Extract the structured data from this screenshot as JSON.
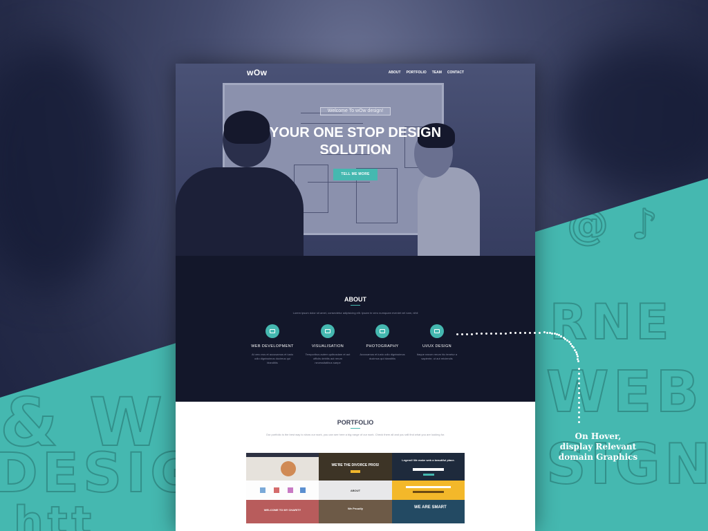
{
  "mockup": {
    "logo": "wOw",
    "nav": [
      "ABOUT",
      "PORTFOLIO",
      "TEAM",
      "CONTACT"
    ],
    "hero": {
      "welcome": "Welcome To wOw design!",
      "title_line1": "YOUR ONE STOP DESIGN",
      "title_line2": "SOLUTION",
      "button": "TELL ME MORE"
    },
    "about": {
      "title": "ABOUT",
      "subtitle": "Lorem ipsum dolor sit amet, consectetur adipisicing elit. Ipsam in vero numquam eveniet vel nam, nihil",
      "services": [
        {
          "title": "WEB DEVELOPMENT",
          "desc": "At vero eos et accusamus et iusto odio dignissimos ducimus qui blanditiis",
          "icon": "camera-icon"
        },
        {
          "title": "VISUALISATION",
          "desc": "Temporibus autem quibusdam et aut officiis debitis aut rerum necessitatibus saepe",
          "icon": "image-icon"
        },
        {
          "title": "PHOTOGRAPHY",
          "desc": "Accusamus et iusto odio dignissimos ducimus qui blanditiis",
          "icon": "calendar-icon"
        },
        {
          "title": "UI/UX DESIGN",
          "desc": "Itaque earum rerum hic tenetur a sapiente, ut aut reiciendis",
          "icon": "cube-icon"
        }
      ]
    },
    "portfolio": {
      "title": "PORTFOLIO",
      "subtitle": "Our portfolio is the best way to show our work, you can see here a big range of our work. Check them all and you will find what you are looking for.",
      "tiles": [
        {
          "caption": ""
        },
        {
          "caption": "WE'RE THE DIVORCE PROS!"
        },
        {
          "caption": "Legend! We make web a beautiful place."
        },
        {
          "caption": ""
        },
        {
          "caption": "ABOUT"
        },
        {
          "caption": ""
        },
        {
          "caption": "WELCOME TO MY CHARITY"
        },
        {
          "caption": "We Proudly"
        },
        {
          "caption": "WE ARE SMART"
        }
      ]
    }
  },
  "annotation": {
    "line1": "On Hover,",
    "line2": "display  Relevant",
    "line3": "domain Graphics"
  },
  "colors": {
    "accent": "#45b8b0",
    "dark": "#13172a",
    "hero": "#3f4669"
  }
}
